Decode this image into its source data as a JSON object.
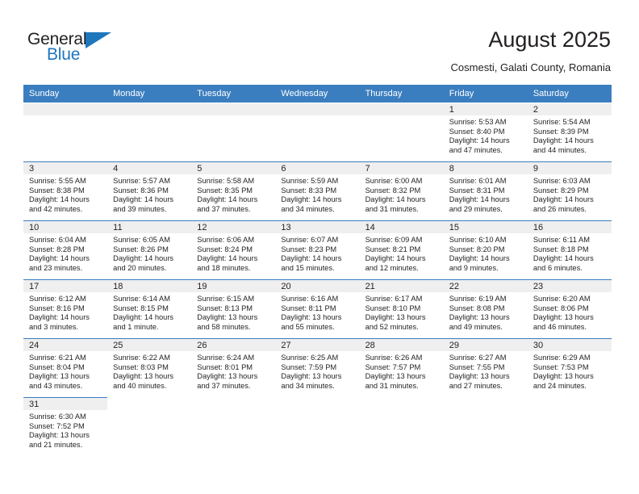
{
  "brand": {
    "name_part1": "General",
    "name_part2": "Blue",
    "logo_icon": "blue-triangle-logo"
  },
  "header": {
    "title": "August 2025",
    "subtitle": "Cosmesti, Galati County, Romania"
  },
  "colors": {
    "header_blue": "#3b7ebf",
    "brand_blue": "#1e76bd",
    "day_band_gray": "#efefef",
    "text": "#231f20"
  },
  "weekday_headers": [
    "Sunday",
    "Monday",
    "Tuesday",
    "Wednesday",
    "Thursday",
    "Friday",
    "Saturday"
  ],
  "weeks": [
    [
      {
        "day": "",
        "blank": true
      },
      {
        "day": "",
        "blank": true
      },
      {
        "day": "",
        "blank": true
      },
      {
        "day": "",
        "blank": true
      },
      {
        "day": "",
        "blank": true
      },
      {
        "day": "1",
        "sunrise": "Sunrise: 5:53 AM",
        "sunset": "Sunset: 8:40 PM",
        "daylight1": "Daylight: 14 hours",
        "daylight2": "and 47 minutes."
      },
      {
        "day": "2",
        "sunrise": "Sunrise: 5:54 AM",
        "sunset": "Sunset: 8:39 PM",
        "daylight1": "Daylight: 14 hours",
        "daylight2": "and 44 minutes."
      }
    ],
    [
      {
        "day": "3",
        "sunrise": "Sunrise: 5:55 AM",
        "sunset": "Sunset: 8:38 PM",
        "daylight1": "Daylight: 14 hours",
        "daylight2": "and 42 minutes."
      },
      {
        "day": "4",
        "sunrise": "Sunrise: 5:57 AM",
        "sunset": "Sunset: 8:36 PM",
        "daylight1": "Daylight: 14 hours",
        "daylight2": "and 39 minutes."
      },
      {
        "day": "5",
        "sunrise": "Sunrise: 5:58 AM",
        "sunset": "Sunset: 8:35 PM",
        "daylight1": "Daylight: 14 hours",
        "daylight2": "and 37 minutes."
      },
      {
        "day": "6",
        "sunrise": "Sunrise: 5:59 AM",
        "sunset": "Sunset: 8:33 PM",
        "daylight1": "Daylight: 14 hours",
        "daylight2": "and 34 minutes."
      },
      {
        "day": "7",
        "sunrise": "Sunrise: 6:00 AM",
        "sunset": "Sunset: 8:32 PM",
        "daylight1": "Daylight: 14 hours",
        "daylight2": "and 31 minutes."
      },
      {
        "day": "8",
        "sunrise": "Sunrise: 6:01 AM",
        "sunset": "Sunset: 8:31 PM",
        "daylight1": "Daylight: 14 hours",
        "daylight2": "and 29 minutes."
      },
      {
        "day": "9",
        "sunrise": "Sunrise: 6:03 AM",
        "sunset": "Sunset: 8:29 PM",
        "daylight1": "Daylight: 14 hours",
        "daylight2": "and 26 minutes."
      }
    ],
    [
      {
        "day": "10",
        "sunrise": "Sunrise: 6:04 AM",
        "sunset": "Sunset: 8:28 PM",
        "daylight1": "Daylight: 14 hours",
        "daylight2": "and 23 minutes."
      },
      {
        "day": "11",
        "sunrise": "Sunrise: 6:05 AM",
        "sunset": "Sunset: 8:26 PM",
        "daylight1": "Daylight: 14 hours",
        "daylight2": "and 20 minutes."
      },
      {
        "day": "12",
        "sunrise": "Sunrise: 6:06 AM",
        "sunset": "Sunset: 8:24 PM",
        "daylight1": "Daylight: 14 hours",
        "daylight2": "and 18 minutes."
      },
      {
        "day": "13",
        "sunrise": "Sunrise: 6:07 AM",
        "sunset": "Sunset: 8:23 PM",
        "daylight1": "Daylight: 14 hours",
        "daylight2": "and 15 minutes."
      },
      {
        "day": "14",
        "sunrise": "Sunrise: 6:09 AM",
        "sunset": "Sunset: 8:21 PM",
        "daylight1": "Daylight: 14 hours",
        "daylight2": "and 12 minutes."
      },
      {
        "day": "15",
        "sunrise": "Sunrise: 6:10 AM",
        "sunset": "Sunset: 8:20 PM",
        "daylight1": "Daylight: 14 hours",
        "daylight2": "and 9 minutes."
      },
      {
        "day": "16",
        "sunrise": "Sunrise: 6:11 AM",
        "sunset": "Sunset: 8:18 PM",
        "daylight1": "Daylight: 14 hours",
        "daylight2": "and 6 minutes."
      }
    ],
    [
      {
        "day": "17",
        "sunrise": "Sunrise: 6:12 AM",
        "sunset": "Sunset: 8:16 PM",
        "daylight1": "Daylight: 14 hours",
        "daylight2": "and 3 minutes."
      },
      {
        "day": "18",
        "sunrise": "Sunrise: 6:14 AM",
        "sunset": "Sunset: 8:15 PM",
        "daylight1": "Daylight: 14 hours",
        "daylight2": "and 1 minute."
      },
      {
        "day": "19",
        "sunrise": "Sunrise: 6:15 AM",
        "sunset": "Sunset: 8:13 PM",
        "daylight1": "Daylight: 13 hours",
        "daylight2": "and 58 minutes."
      },
      {
        "day": "20",
        "sunrise": "Sunrise: 6:16 AM",
        "sunset": "Sunset: 8:11 PM",
        "daylight1": "Daylight: 13 hours",
        "daylight2": "and 55 minutes."
      },
      {
        "day": "21",
        "sunrise": "Sunrise: 6:17 AM",
        "sunset": "Sunset: 8:10 PM",
        "daylight1": "Daylight: 13 hours",
        "daylight2": "and 52 minutes."
      },
      {
        "day": "22",
        "sunrise": "Sunrise: 6:19 AM",
        "sunset": "Sunset: 8:08 PM",
        "daylight1": "Daylight: 13 hours",
        "daylight2": "and 49 minutes."
      },
      {
        "day": "23",
        "sunrise": "Sunrise: 6:20 AM",
        "sunset": "Sunset: 8:06 PM",
        "daylight1": "Daylight: 13 hours",
        "daylight2": "and 46 minutes."
      }
    ],
    [
      {
        "day": "24",
        "sunrise": "Sunrise: 6:21 AM",
        "sunset": "Sunset: 8:04 PM",
        "daylight1": "Daylight: 13 hours",
        "daylight2": "and 43 minutes."
      },
      {
        "day": "25",
        "sunrise": "Sunrise: 6:22 AM",
        "sunset": "Sunset: 8:03 PM",
        "daylight1": "Daylight: 13 hours",
        "daylight2": "and 40 minutes."
      },
      {
        "day": "26",
        "sunrise": "Sunrise: 6:24 AM",
        "sunset": "Sunset: 8:01 PM",
        "daylight1": "Daylight: 13 hours",
        "daylight2": "and 37 minutes."
      },
      {
        "day": "27",
        "sunrise": "Sunrise: 6:25 AM",
        "sunset": "Sunset: 7:59 PM",
        "daylight1": "Daylight: 13 hours",
        "daylight2": "and 34 minutes."
      },
      {
        "day": "28",
        "sunrise": "Sunrise: 6:26 AM",
        "sunset": "Sunset: 7:57 PM",
        "daylight1": "Daylight: 13 hours",
        "daylight2": "and 31 minutes."
      },
      {
        "day": "29",
        "sunrise": "Sunrise: 6:27 AM",
        "sunset": "Sunset: 7:55 PM",
        "daylight1": "Daylight: 13 hours",
        "daylight2": "and 27 minutes."
      },
      {
        "day": "30",
        "sunrise": "Sunrise: 6:29 AM",
        "sunset": "Sunset: 7:53 PM",
        "daylight1": "Daylight: 13 hours",
        "daylight2": "and 24 minutes."
      }
    ],
    [
      {
        "day": "31",
        "sunrise": "Sunrise: 6:30 AM",
        "sunset": "Sunset: 7:52 PM",
        "daylight1": "Daylight: 13 hours",
        "daylight2": "and 21 minutes."
      },
      {
        "day": "",
        "blank": true
      },
      {
        "day": "",
        "blank": true
      },
      {
        "day": "",
        "blank": true
      },
      {
        "day": "",
        "blank": true
      },
      {
        "day": "",
        "blank": true
      },
      {
        "day": "",
        "blank": true
      }
    ]
  ]
}
